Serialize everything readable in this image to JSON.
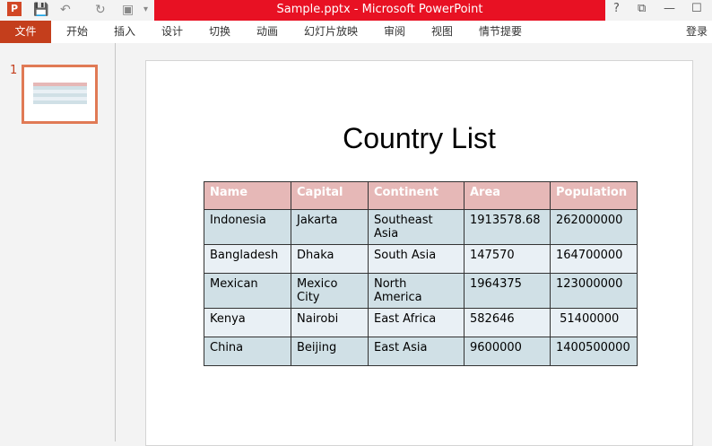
{
  "window": {
    "title": "Sample.pptx -  Microsoft PowerPoint",
    "help": "?",
    "restore": "⧉",
    "minimize": "—",
    "maximize": "☐"
  },
  "qat": {
    "app_icon": "P",
    "save": "💾",
    "undo": "↶",
    "redo": "↻",
    "present": "▣",
    "more": "▾"
  },
  "ribbon": {
    "tabs": [
      "文件",
      "开始",
      "插入",
      "设计",
      "切换",
      "动画",
      "幻灯片放映",
      "审阅",
      "视图",
      "情节提要"
    ],
    "signin": "登录"
  },
  "thumbnails": {
    "number": "1"
  },
  "slide": {
    "title": "Country List",
    "headers": [
      "Name",
      "Capital",
      "Continent",
      "Area",
      "Population"
    ],
    "rows": [
      [
        "Indonesia",
        "Jakarta",
        "Southeast Asia",
        "1913578.68",
        "262000000"
      ],
      [
        "Bangladesh",
        "Dhaka",
        "South Asia",
        "147570",
        "164700000"
      ],
      [
        "Mexican",
        "Mexico City",
        "North America",
        "1964375",
        "123000000"
      ],
      [
        "Kenya",
        "Nairobi",
        "East Africa",
        "582646",
        " 51400000"
      ],
      [
        "China",
        "Beijing",
        "East Asia",
        "9600000",
        "1400500000"
      ]
    ]
  }
}
